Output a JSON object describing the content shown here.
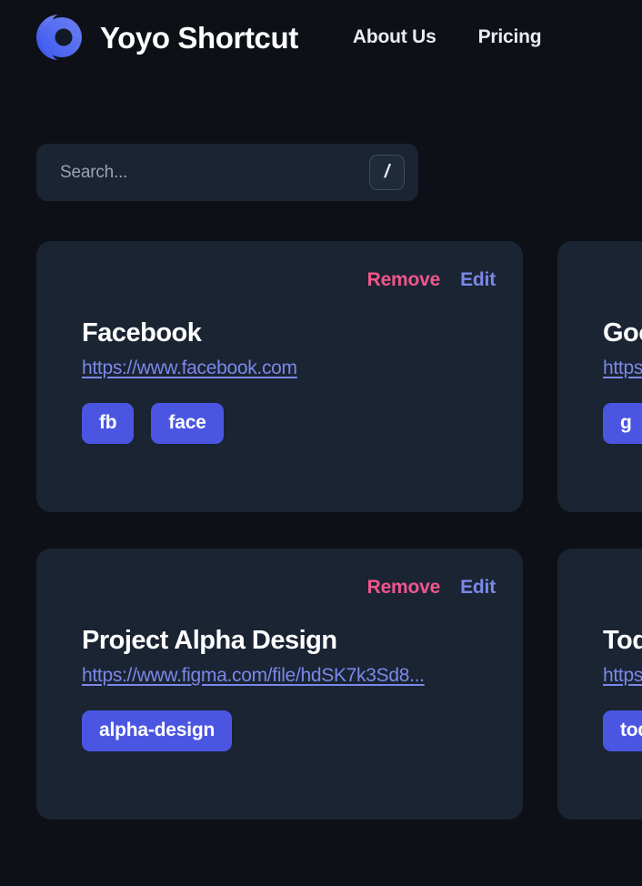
{
  "header": {
    "brand_name": "Yoyo Shortcut",
    "logo_icon": "yoyo-logo-icon",
    "nav_items": [
      {
        "label": "About Us"
      },
      {
        "label": "Pricing"
      }
    ]
  },
  "search": {
    "placeholder": "Search...",
    "value": "",
    "shortcut_key": "/"
  },
  "actions": {
    "remove_label": "Remove",
    "edit_label": "Edit"
  },
  "cards": [
    {
      "title": "Facebook",
      "url": "https://www.facebook.com",
      "tags": [
        "fb",
        "face"
      ]
    },
    {
      "title": "Google",
      "url": "https://www.google.com",
      "tags": [
        "g"
      ]
    },
    {
      "title": "Project Alpha Design",
      "url": "https://www.figma.com/file/hdSK7k3Sd8...",
      "tags": [
        "alpha-design"
      ]
    },
    {
      "title": "Todoist",
      "url": "https://todoist.com",
      "tags": [
        "todo"
      ]
    }
  ],
  "colors": {
    "page_background": "#0d1117",
    "card_background": "#1a2433",
    "search_background": "#1b2433",
    "tag_background": "#4a56e2",
    "remove_accent": "#f0568c",
    "edit_accent": "#7b88e8",
    "link_accent": "#7b88e8",
    "logo_gradient_start": "#3b5bf5",
    "logo_gradient_end": "#6f7ff0"
  }
}
